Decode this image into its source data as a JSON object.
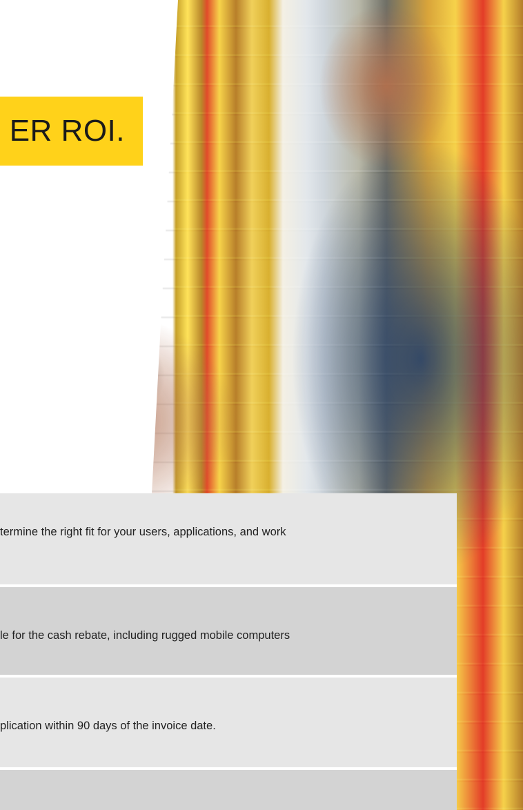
{
  "headline": {
    "text": "ER ROI."
  },
  "steps": [
    {
      "text": "termine the right fit for your users, applications, and work"
    },
    {
      "text": "le for the cash rebate, including rugged mobile computers"
    },
    {
      "text": "plication within 90 days of the invoice date."
    },
    {
      "text": ""
    }
  ]
}
